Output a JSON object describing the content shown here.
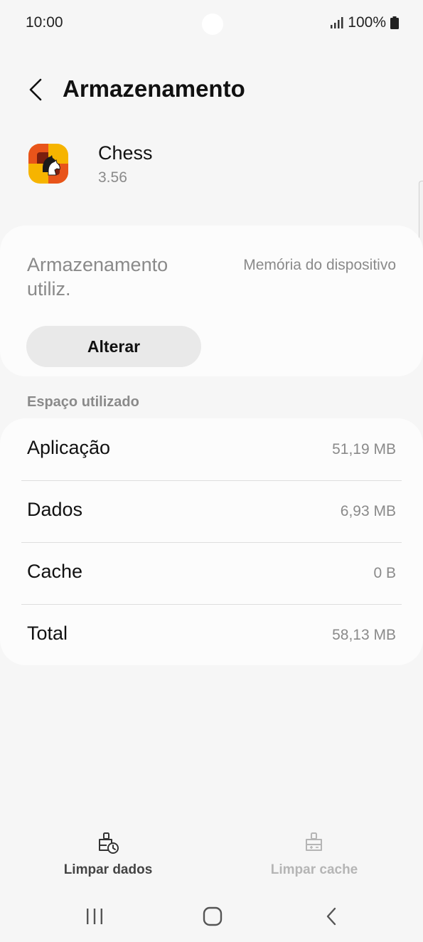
{
  "status_bar": {
    "time": "10:00",
    "battery_percent": "100%",
    "icons": [
      "signal-icon",
      "battery-icon"
    ]
  },
  "header": {
    "title": "Armazenamento",
    "back_icon": "back-arrow-icon"
  },
  "app": {
    "name": "Chess",
    "version": "3.56",
    "icon": "chess-app-icon"
  },
  "storage": {
    "label": "Armazenamento utiliz.",
    "value": "Memória do dispositivo",
    "change_button": "Alterar"
  },
  "usage": {
    "section_label": "Espaço utilizado",
    "rows": [
      {
        "label": "Aplicação",
        "value": "51,19 MB"
      },
      {
        "label": "Dados",
        "value": "6,93 MB"
      },
      {
        "label": "Cache",
        "value": "0 B"
      },
      {
        "label": "Total",
        "value": "58,13 MB"
      }
    ]
  },
  "actions": {
    "clear_data": {
      "label": "Limpar dados",
      "enabled": true,
      "icon": "clear-data-icon"
    },
    "clear_cache": {
      "label": "Limpar cache",
      "enabled": false,
      "icon": "clear-cache-icon"
    }
  },
  "nav": {
    "icons": [
      "recents-icon",
      "home-icon",
      "back-icon"
    ]
  },
  "colors": {
    "background": "#f6f6f6",
    "card": "#fcfcfc",
    "button": "#e9e9e9",
    "secondary_text": "#8a8a8a",
    "disabled_text": "#b5b5b5"
  }
}
